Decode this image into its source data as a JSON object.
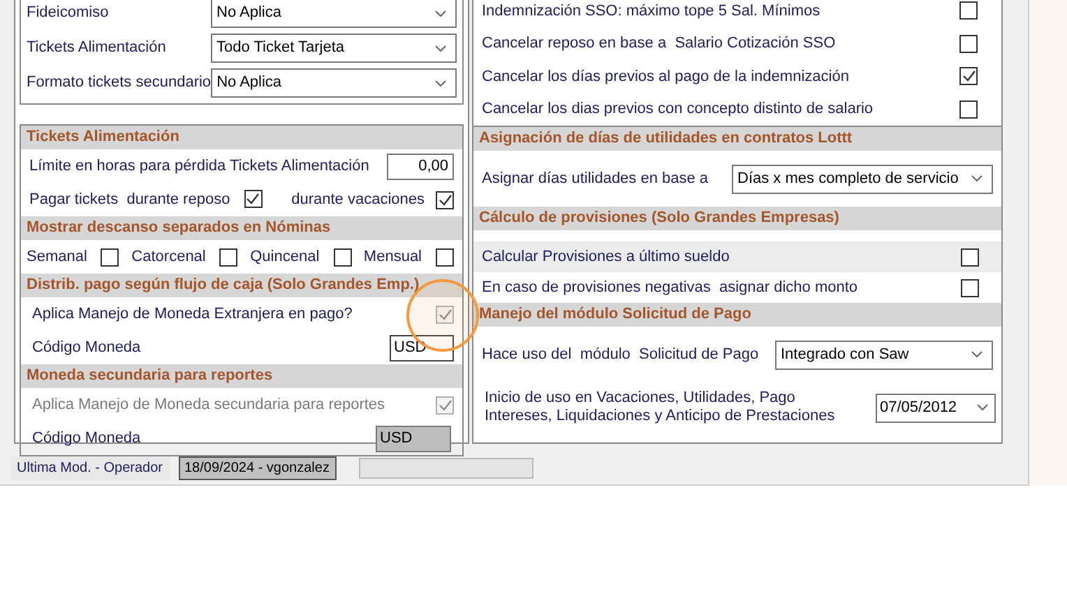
{
  "settings_top": [
    {
      "label": "Fideicomiso",
      "value": "No Aplica"
    },
    {
      "label": "Tickets Alimentación",
      "value": "Todo Ticket Tarjeta"
    },
    {
      "label": "Formato tickets secundario",
      "value": "No Aplica"
    }
  ],
  "left_sections": [
    {
      "title": "Tickets Alimentación",
      "rows": [
        {
          "kind": "number",
          "label": "Límite en horas para pérdida Tickets Alimentación",
          "value": "0,00"
        },
        {
          "kind": "pair",
          "label": "Pagar tickets  durante reposo",
          "checked": true,
          "label2": "durante vacaciones",
          "checked2": true
        }
      ]
    },
    {
      "title": "Mostrar descanso separados en Nóminas",
      "rows": [
        {
          "kind": "checks",
          "items": [
            {
              "label": "Semanal",
              "checked": false
            },
            {
              "label": "Catorcenal",
              "checked": false
            },
            {
              "label": "Quincenal",
              "checked": false
            },
            {
              "label": "Mensual",
              "checked": false
            }
          ]
        }
      ]
    },
    {
      "title": "Distrib. pago según flujo de caja (Solo Grandes Emp.)",
      "rows": [
        {
          "kind": "check",
          "label": "Aplica Manejo de Moneda Extranjera en pago?",
          "checked": true,
          "disabled": true,
          "label_disabled": false
        },
        {
          "kind": "code",
          "label": "Código Moneda",
          "value": "USD",
          "disabled": false
        }
      ]
    },
    {
      "title": "Moneda secundaria para reportes",
      "rows": [
        {
          "kind": "check",
          "label": "Aplica Manejo de Moneda secundaria para reportes",
          "checked": true,
          "disabled": true,
          "label_disabled": true
        },
        {
          "kind": "code",
          "label": "Código Moneda",
          "value": "USD",
          "disabled": true
        }
      ]
    }
  ],
  "right_checks": [
    {
      "label": "Indemnización SSO: máximo tope 5 Sal. Mínimos",
      "checked": false
    },
    {
      "label": "Cancelar reposo en base a  Salario Cotización SSO",
      "checked": false
    },
    {
      "label": "Cancelar los días previos al pago de la indemnización",
      "checked": true
    },
    {
      "label": "Cancelar los dias previos con concepto distinto de salario",
      "checked": false
    }
  ],
  "right_sections": [
    {
      "title": "Asignación de días de utilidades en contratos Lottt",
      "rows": [
        {
          "kind": "select",
          "label": "Asignar días utilidades en base a",
          "value": "Días x mes completo de servicio"
        }
      ]
    },
    {
      "title": "Cálculo de provisiones (Solo Grandes Empresas)",
      "rows": [
        {
          "kind": "check",
          "label": "Calcular Provisiones a último sueldo",
          "checked": false,
          "highlighted": true
        },
        {
          "kind": "check",
          "label": "En caso de provisiones negativas  asignar dicho monto",
          "checked": false,
          "highlighted": false
        }
      ]
    },
    {
      "title": "Manejo del módulo Solicitud de Pago",
      "rows": [
        {
          "kind": "select",
          "label": "Hace uso del  módulo  Solicitud de Pago",
          "value": "Integrado con Saw"
        },
        {
          "kind": "date",
          "label": "Inicio de uso en Vacaciones, Utilidades, Pago Intereses, Liquidaciones y Anticipo de Prestaciones",
          "value": "07/05/2012"
        }
      ]
    }
  ],
  "status": {
    "label": "Ultima Mod. - Operador",
    "value": "18/09/2024 - vgonzalez"
  }
}
